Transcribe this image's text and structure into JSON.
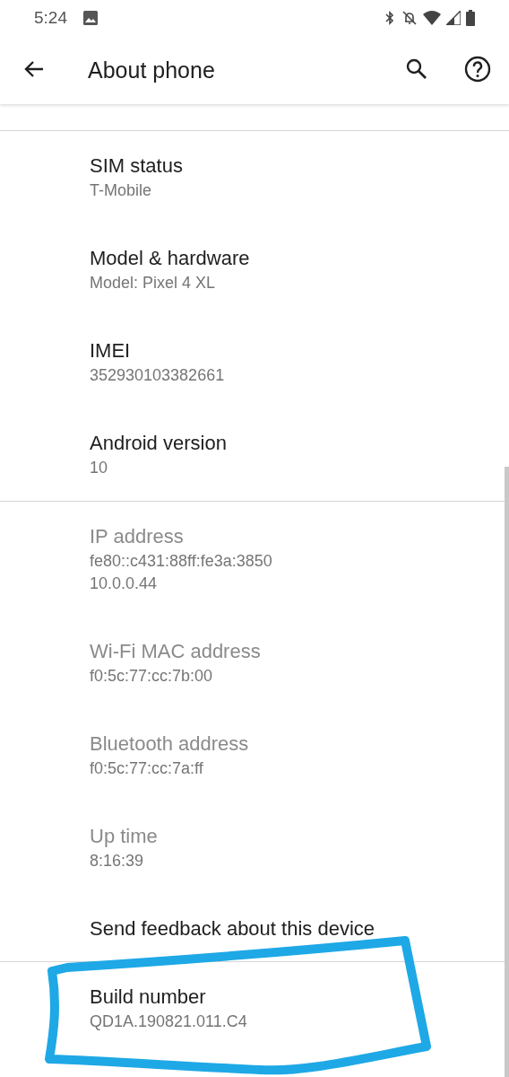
{
  "status_bar": {
    "time": "5:24"
  },
  "app_bar": {
    "title": "About phone"
  },
  "groups": [
    {
      "items": [
        {
          "title": "SIM status",
          "summary": [
            "T-Mobile"
          ],
          "disabled": false
        },
        {
          "title": "Model & hardware",
          "summary": [
            "Model: Pixel 4 XL"
          ],
          "disabled": false
        },
        {
          "title": "IMEI",
          "summary": [
            "352930103382661"
          ],
          "disabled": false
        },
        {
          "title": "Android version",
          "summary": [
            "10"
          ],
          "disabled": false
        }
      ]
    },
    {
      "items": [
        {
          "title": "IP address",
          "summary": [
            "fe80::c431:88ff:fe3a:3850",
            "10.0.0.44"
          ],
          "disabled": true
        },
        {
          "title": "Wi-Fi MAC address",
          "summary": [
            "f0:5c:77:cc:7b:00"
          ],
          "disabled": true
        },
        {
          "title": "Bluetooth address",
          "summary": [
            "f0:5c:77:cc:7a:ff"
          ],
          "disabled": true
        },
        {
          "title": "Up time",
          "summary": [
            "8:16:39"
          ],
          "disabled": true
        },
        {
          "title": "Send feedback about this device",
          "disabled": false
        }
      ]
    },
    {
      "items": [
        {
          "title": "Build number",
          "summary": [
            "QD1A.190821.011.C4"
          ],
          "disabled": false
        }
      ]
    }
  ]
}
